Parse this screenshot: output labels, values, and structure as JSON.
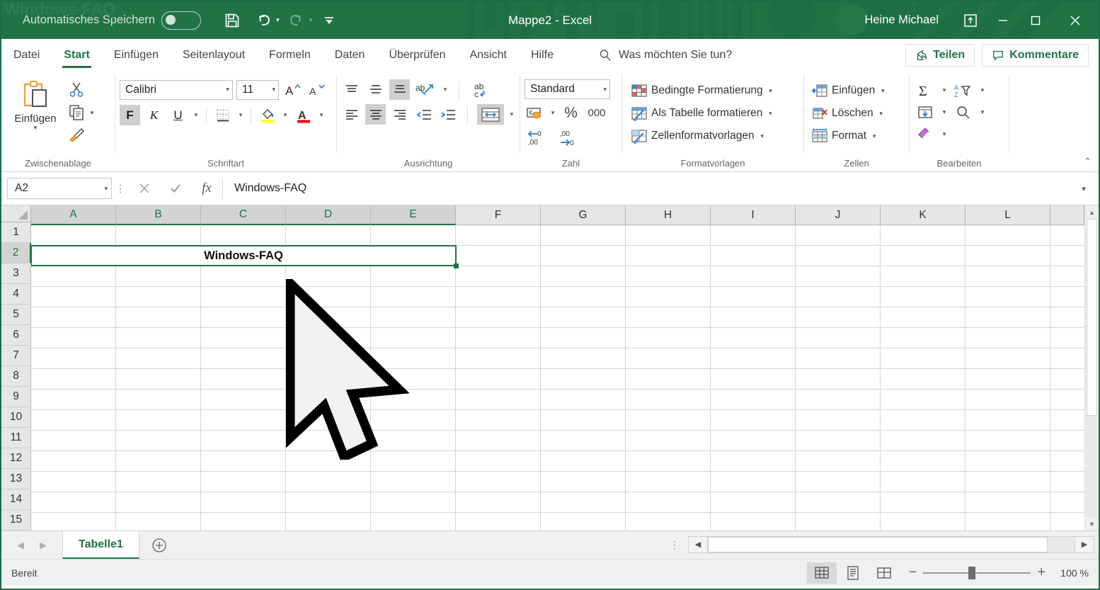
{
  "window": {
    "watermark": "Windows-FAQ",
    "title": "Mappe2  -  Excel",
    "user": "Heine Michael",
    "autosave_label": "Automatisches Speichern",
    "qat": [
      {
        "name": "save-icon",
        "label": "Speichern"
      },
      {
        "name": "undo-icon",
        "label": "Rückgängig"
      },
      {
        "name": "redo-icon",
        "label": "Wiederholen"
      },
      {
        "name": "customize-qat-icon",
        "label": "Symbolleiste für den Schnellzugriff anpassen"
      }
    ],
    "controls": [
      {
        "name": "ribbon-display-options-icon",
        "label": "Menüband-Anzeigeoptionen"
      },
      {
        "name": "minimize-icon",
        "label": "Minimieren"
      },
      {
        "name": "maximize-icon",
        "label": "Maximieren"
      },
      {
        "name": "close-icon",
        "label": "Schließen"
      }
    ]
  },
  "menu": {
    "tabs": [
      {
        "label": "Datei",
        "active": false
      },
      {
        "label": "Start",
        "active": true
      },
      {
        "label": "Einfügen",
        "active": false
      },
      {
        "label": "Seitenlayout",
        "active": false
      },
      {
        "label": "Formeln",
        "active": false
      },
      {
        "label": "Daten",
        "active": false
      },
      {
        "label": "Überprüfen",
        "active": false
      },
      {
        "label": "Ansicht",
        "active": false
      },
      {
        "label": "Hilfe",
        "active": false
      }
    ],
    "tell_me": "Was möchten Sie tun?",
    "share_label": "Teilen",
    "comments_label": "Kommentare"
  },
  "ribbon": {
    "groups": [
      {
        "label": "Zwischenablage",
        "paste_label": "Einfügen",
        "items": [
          "Ausschneiden",
          "Kopieren",
          "Format übertragen"
        ]
      },
      {
        "label": "Schriftart",
        "font_name": "Calibri",
        "font_size": "11",
        "bold": "F",
        "italic": "K",
        "underline": "U",
        "grow_font": "A",
        "shrink_font": "A",
        "bold_active": true,
        "fill_color": "#FFFF00",
        "font_color": "#FF0000"
      },
      {
        "label": "Ausrichtung",
        "wrap_text_label": "Textumbruch",
        "merge_label": "Verbinden und zentrieren",
        "merge_active": true,
        "align_center_active": true,
        "valign_bottom_active": true
      },
      {
        "label": "Zahl",
        "format": "Standard",
        "percent": "%",
        "thousands": "000"
      },
      {
        "label": "Formatvorlagen",
        "items": [
          "Bedingte Formatierung",
          "Als Tabelle formatieren",
          "Zellenformatvorlagen"
        ]
      },
      {
        "label": "Zellen",
        "items": [
          "Einfügen",
          "Löschen",
          "Format"
        ]
      },
      {
        "label": "Bearbeiten",
        "items": [
          "Summe",
          "Sortieren und Filtern",
          "Füllbereich",
          "Suchen und Auswählen",
          "Löschen"
        ]
      }
    ]
  },
  "formula_bar": {
    "name_box": "A2",
    "cancel_icon": "close-icon",
    "confirm_icon": "check-icon",
    "function_icon": "fx",
    "value": "Windows-FAQ"
  },
  "grid": {
    "columns": [
      "A",
      "B",
      "C",
      "D",
      "E",
      "F",
      "G",
      "H",
      "I",
      "J",
      "K",
      "L"
    ],
    "selected_columns": [
      "A",
      "B",
      "C",
      "D",
      "E"
    ],
    "rows": [
      "1",
      "2",
      "3",
      "4",
      "5",
      "6",
      "7",
      "8",
      "9",
      "10",
      "11",
      "12",
      "13",
      "14",
      "15"
    ],
    "selected_row": "2",
    "selection_range": "A2:E2",
    "cells": [
      {
        "ref": "A2",
        "value": "Windows-FAQ",
        "bold": true,
        "align": "center",
        "merged": "A2:E2"
      }
    ]
  },
  "sheet_bar": {
    "tabs": [
      {
        "label": "Tabelle1",
        "active": true
      }
    ],
    "add_sheet_icon": "plus-icon"
  },
  "status_bar": {
    "text": "Bereit",
    "views": [
      {
        "name": "normal-view-icon",
        "label": "Normal",
        "active": true
      },
      {
        "name": "page-layout-view-icon",
        "label": "Seitenlayout",
        "active": false
      },
      {
        "name": "page-break-view-icon",
        "label": "Umbruchvorschau",
        "active": false
      }
    ],
    "zoom_out": "−",
    "zoom_in": "+",
    "zoom_level": "100 %"
  },
  "colors": {
    "brand_green": "#217346",
    "titlebar": "#217346",
    "selection_border": "#217346"
  }
}
